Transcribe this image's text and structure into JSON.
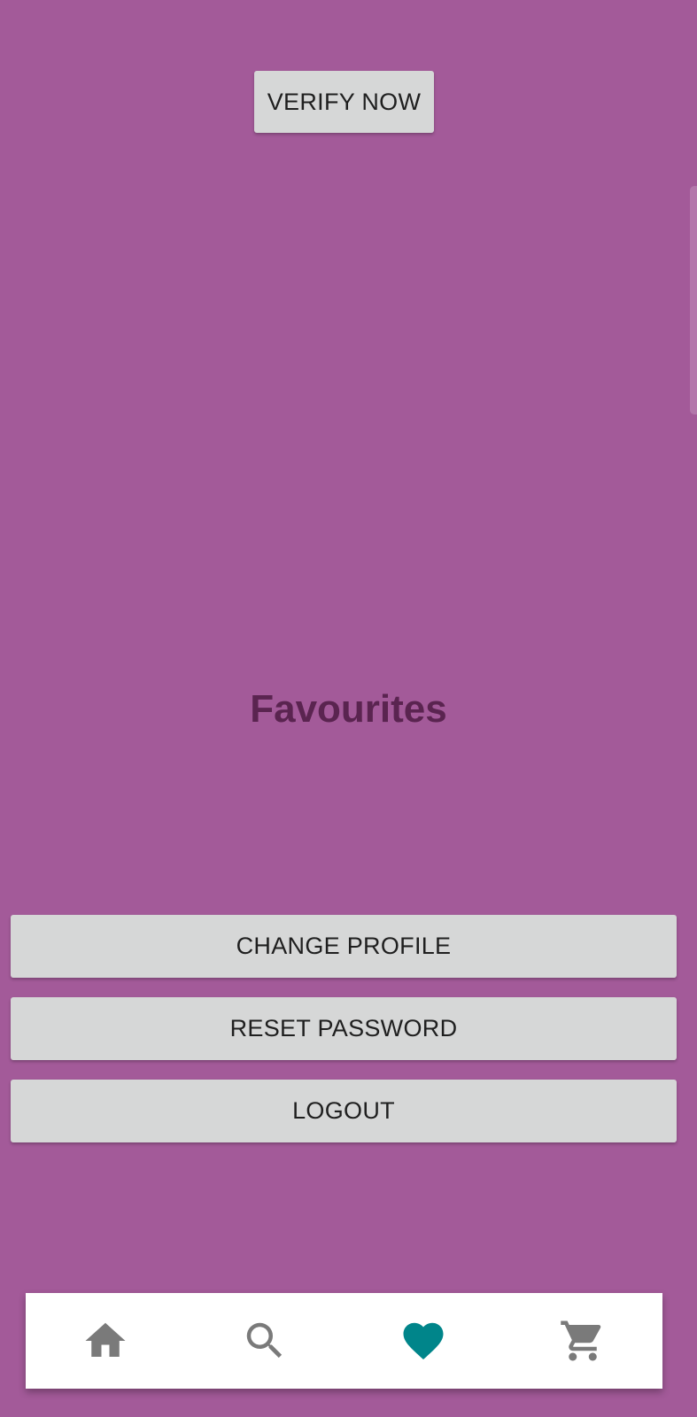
{
  "buttons": {
    "verify": "VERIFY NOW",
    "change_profile": "CHANGE PROFILE",
    "reset_password": "RESET PASSWORD",
    "logout": "LOGOUT"
  },
  "page": {
    "title": "Favourites"
  },
  "bottom_nav": {
    "items": [
      {
        "icon": "home-icon",
        "selected": false
      },
      {
        "icon": "search-icon",
        "selected": false
      },
      {
        "icon": "heart-icon",
        "selected": true
      },
      {
        "icon": "cart-icon",
        "selected": false
      }
    ]
  },
  "colors": {
    "background": "#a35a99",
    "title": "#5a2450",
    "nav_active": "#00858a",
    "nav_inactive": "#7a7a7a"
  }
}
